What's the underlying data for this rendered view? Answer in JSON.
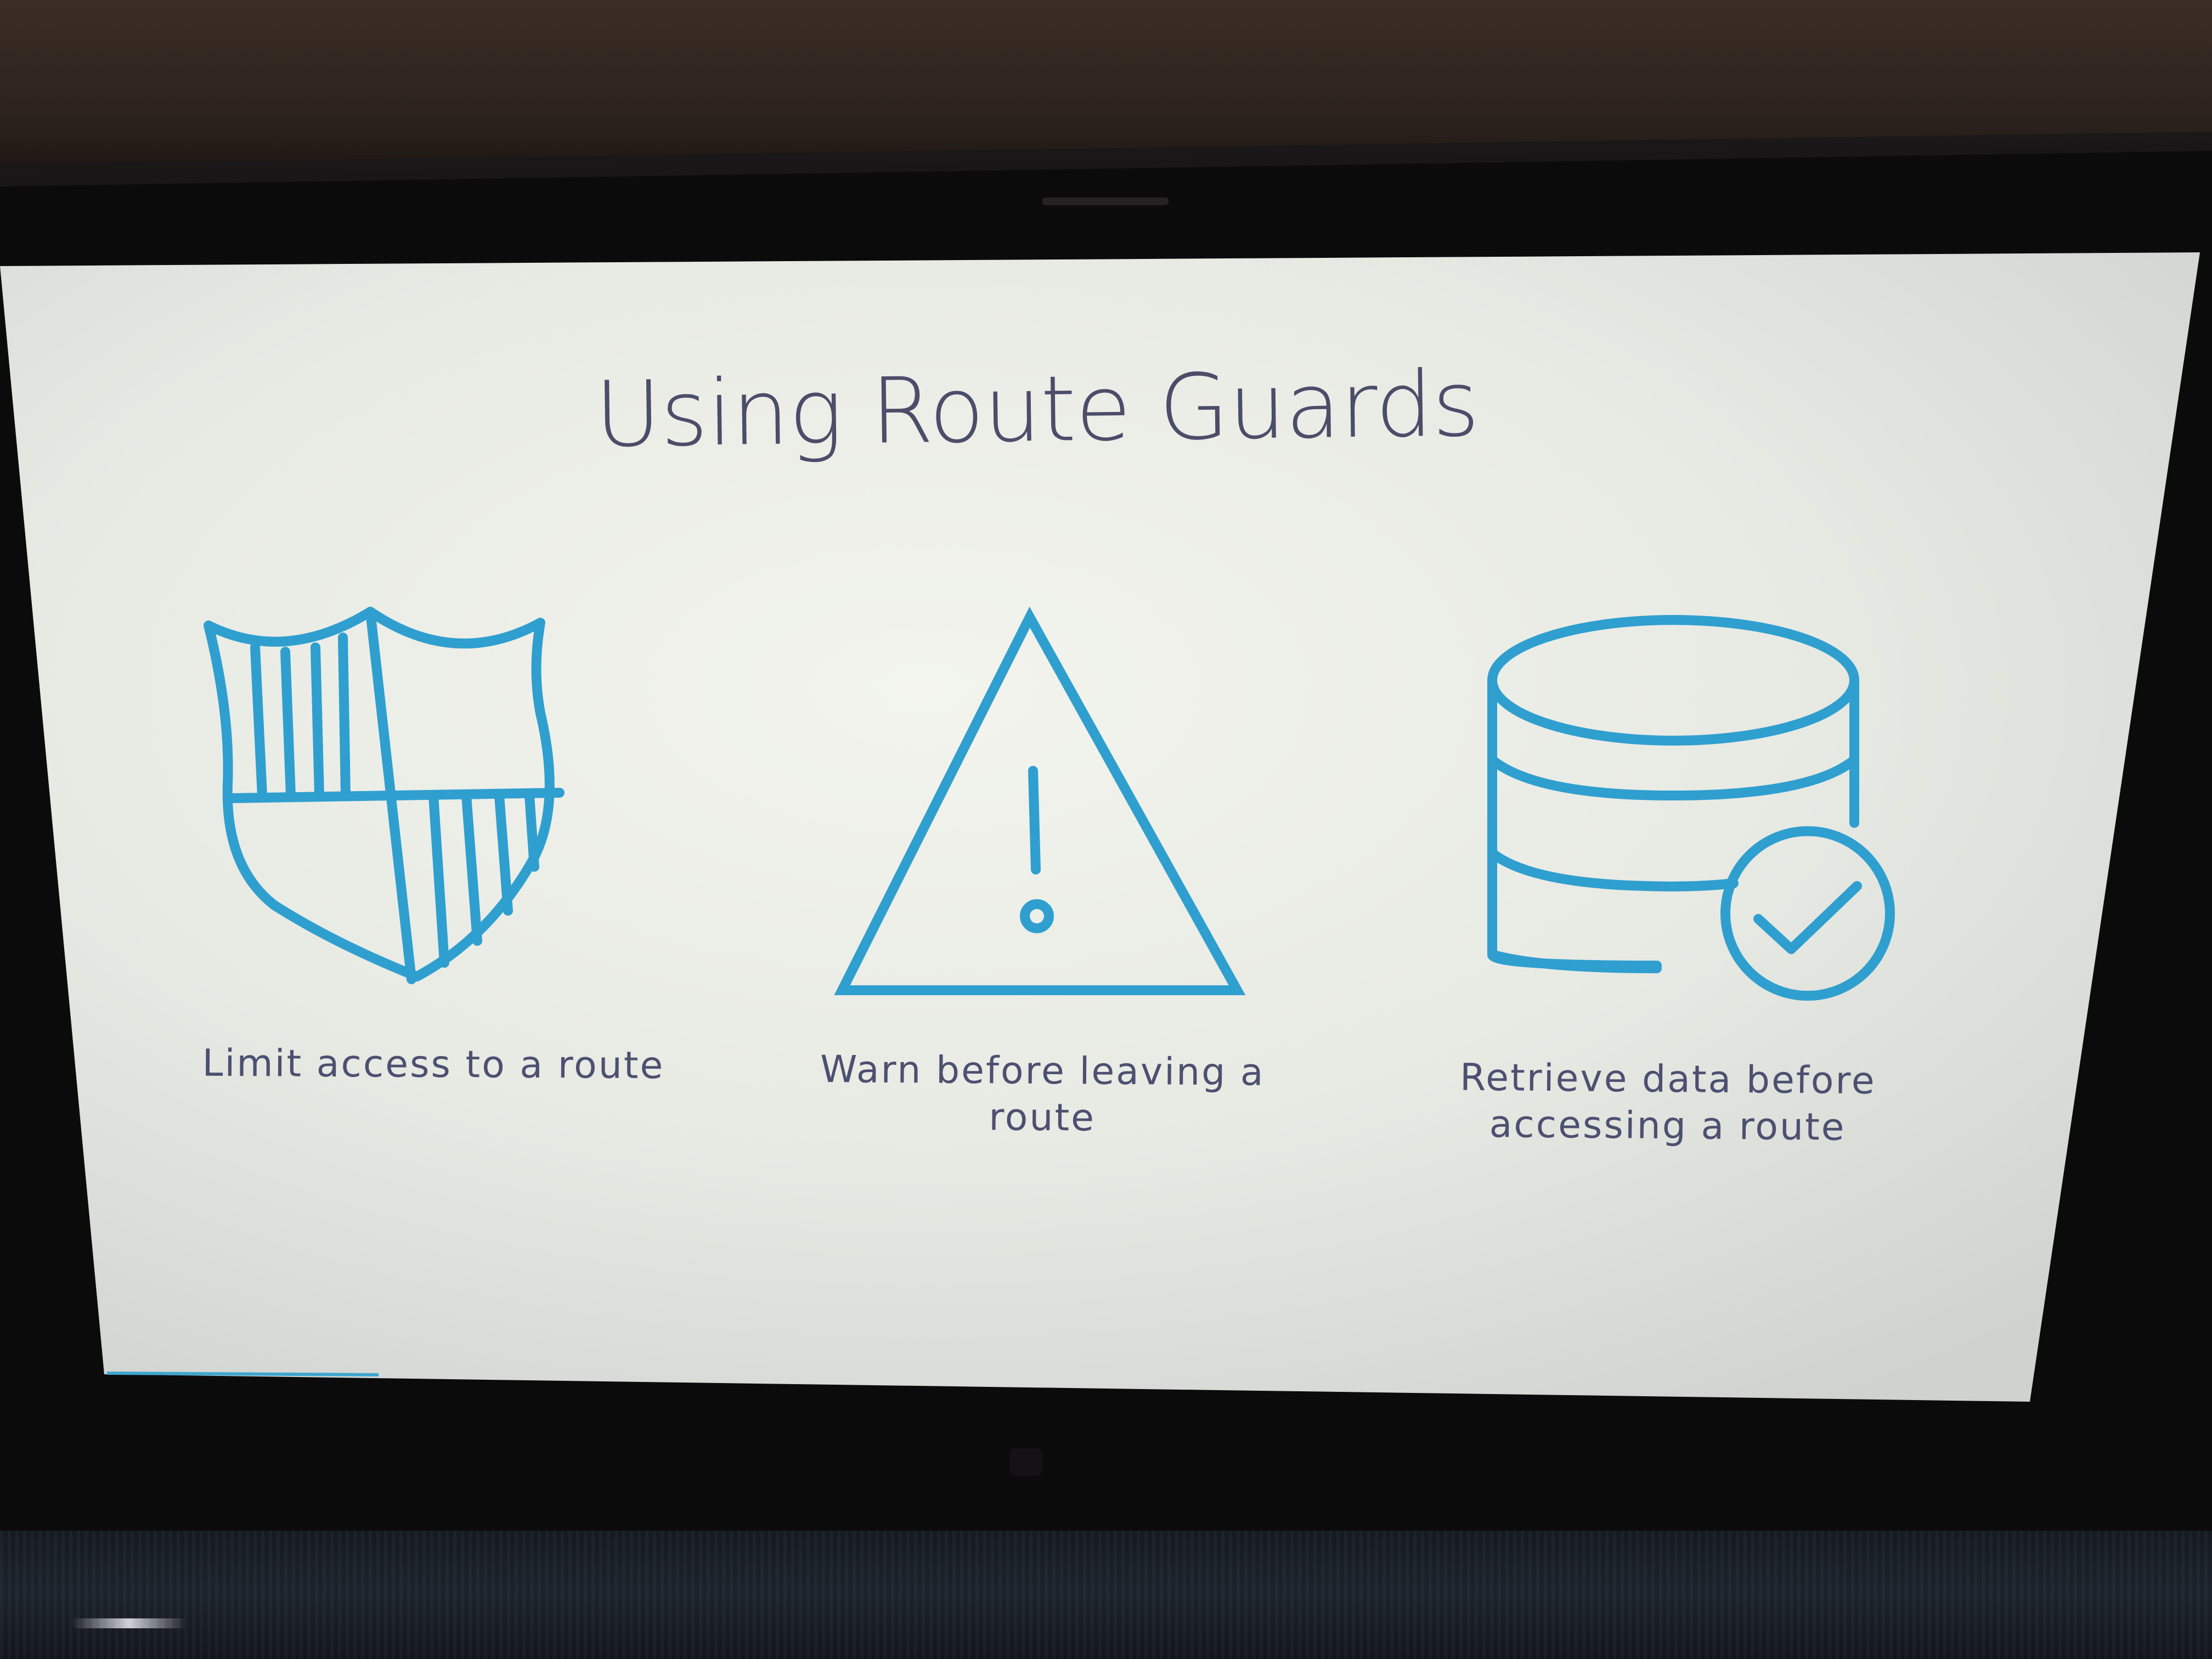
{
  "slide": {
    "title": "Using Route Guards",
    "items": [
      {
        "icon": "shield-icon",
        "caption": "Limit access to a route"
      },
      {
        "icon": "warning-triangle-icon",
        "caption": "Warn before leaving a route"
      },
      {
        "icon": "database-check-icon",
        "caption": "Retrieve data before accessing a route"
      }
    ]
  },
  "colors": {
    "icon_stroke": "#2f9fcf",
    "title_text": "#4b4d69",
    "caption_text": "#4c5070",
    "slide_background": "#e9ebe6"
  }
}
